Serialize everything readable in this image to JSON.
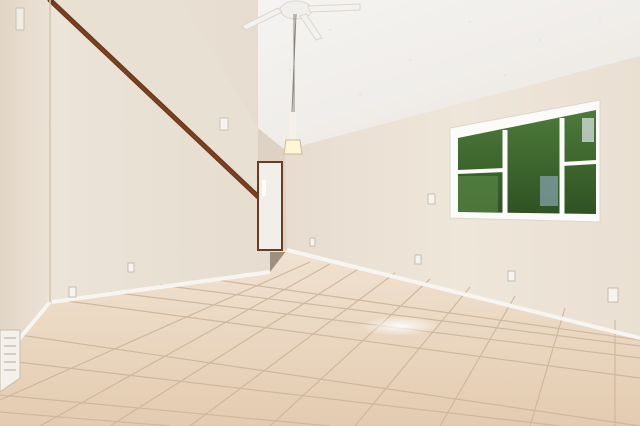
{
  "scene": {
    "subject": "empty-room-interior",
    "colors": {
      "wall_light": "#efe6da",
      "wall_mid": "#e6dccf",
      "wall_shadow": "#d8ccbd",
      "ceiling": "#f3f1ee",
      "floor_tile": "#e9d3bb",
      "grout": "#cdb59b",
      "baseboard": "#f7f4ef",
      "rail_wood": "#6e3a1c",
      "window_frame": "#fbfbfa",
      "foliage": "#3f6a2f"
    }
  }
}
